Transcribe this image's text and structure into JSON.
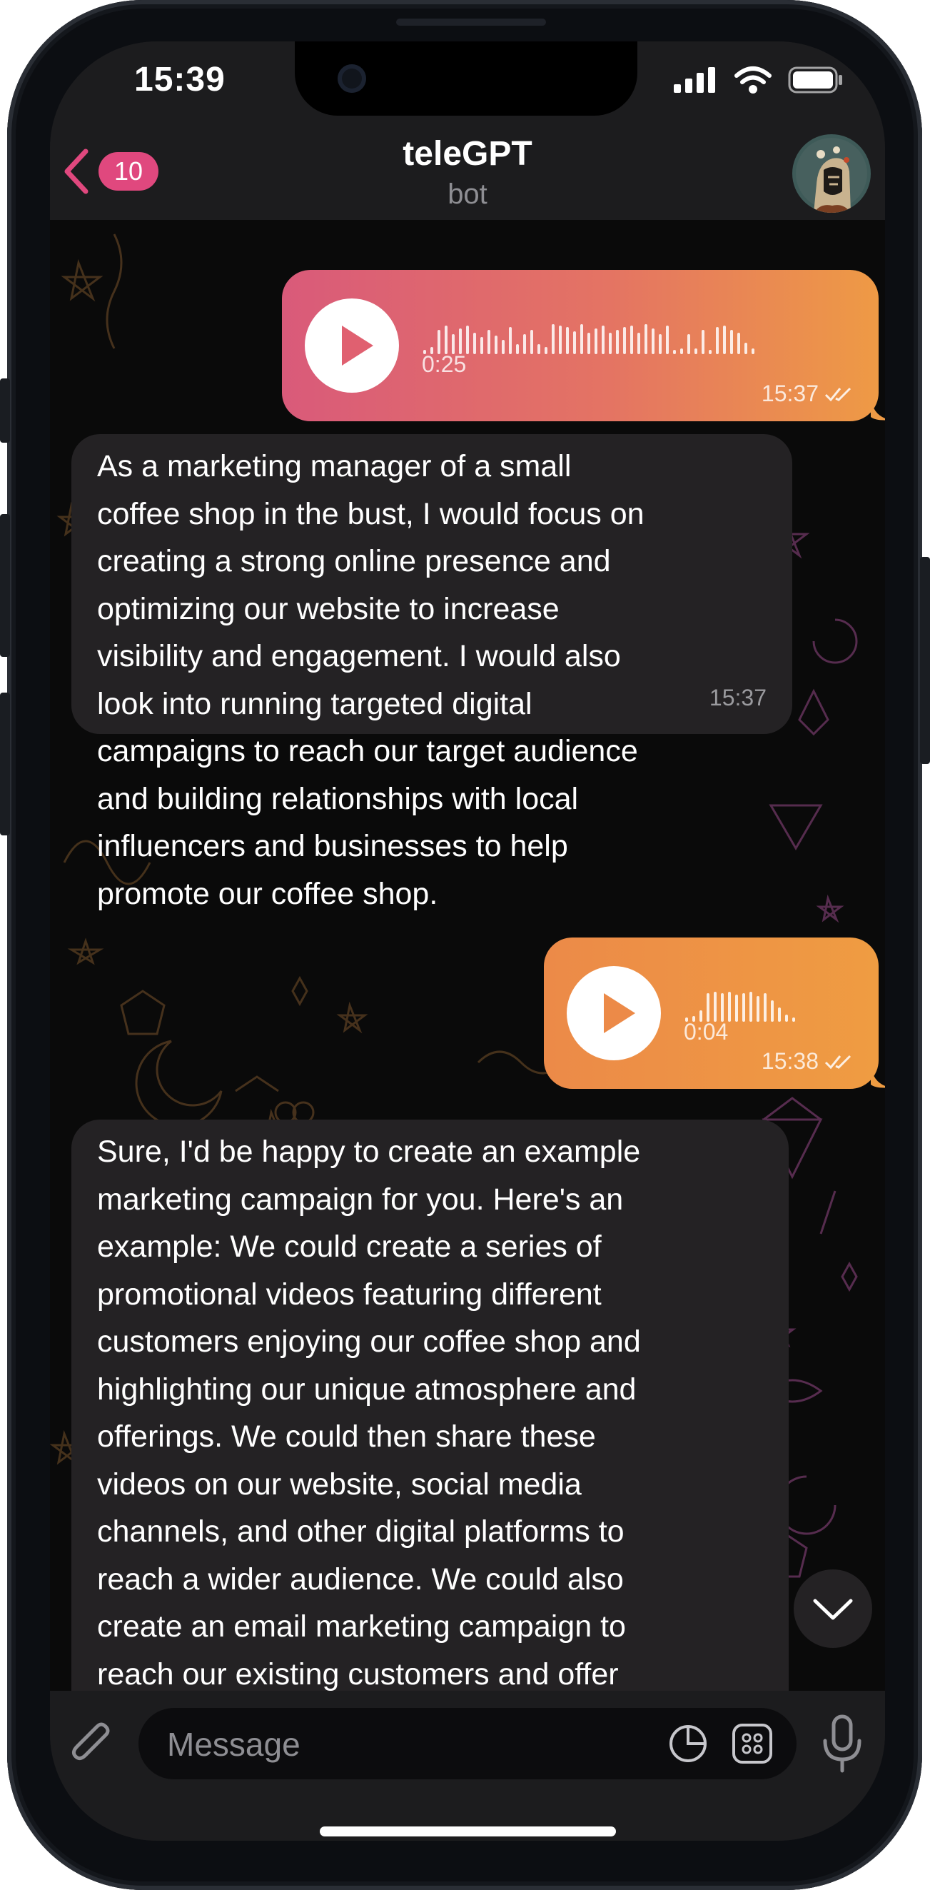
{
  "status_bar": {
    "time": "15:39"
  },
  "header": {
    "title": "teleGPT",
    "subtitle": "bot",
    "unread_count": "10"
  },
  "messages": [
    {
      "type": "voice",
      "duration": "0:25",
      "time": "15:37"
    },
    {
      "type": "text",
      "text": "As a marketing manager of a small\ncoffee shop in the bust, I would focus on\ncreating a strong online presence and\noptimizing our website to increase\nvisibility and engagement. I would also\nlook into running targeted digital\ncampaigns to reach our target audience\nand building relationships with local\ninfluencers and businesses to help\npromote our coffee shop.",
      "time": "15:37"
    },
    {
      "type": "voice",
      "duration": "0:04",
      "time": "15:38"
    },
    {
      "type": "text",
      "text": "Sure, I'd be happy to create an example\nmarketing campaign for you. Here's an\nexample: We could create a series of\npromotional videos featuring different\ncustomers enjoying our coffee shop and\nhighlighting our unique atmosphere and\nofferings. We could then share these\nvideos on our website, social media\nchannels, and other digital platforms to\nreach a wider audience. We could also\ncreate an email marketing campaign to\nreach our existing customers and offer\nthem discounts and special offers."
    }
  ],
  "composer": {
    "placeholder": "Message"
  },
  "colors": {
    "accent": "#e0487e",
    "voice_gradient_start": "#e0587a",
    "voice_gradient_end": "#f0a040",
    "incoming_bubble": "#242224"
  },
  "icons": [
    "back-chevron-icon",
    "signal-icon",
    "wifi-icon",
    "battery-icon",
    "play-icon",
    "read-check-icon",
    "chevron-down-icon",
    "attach-icon",
    "sticker-icon",
    "command-menu-icon",
    "microphone-icon"
  ]
}
